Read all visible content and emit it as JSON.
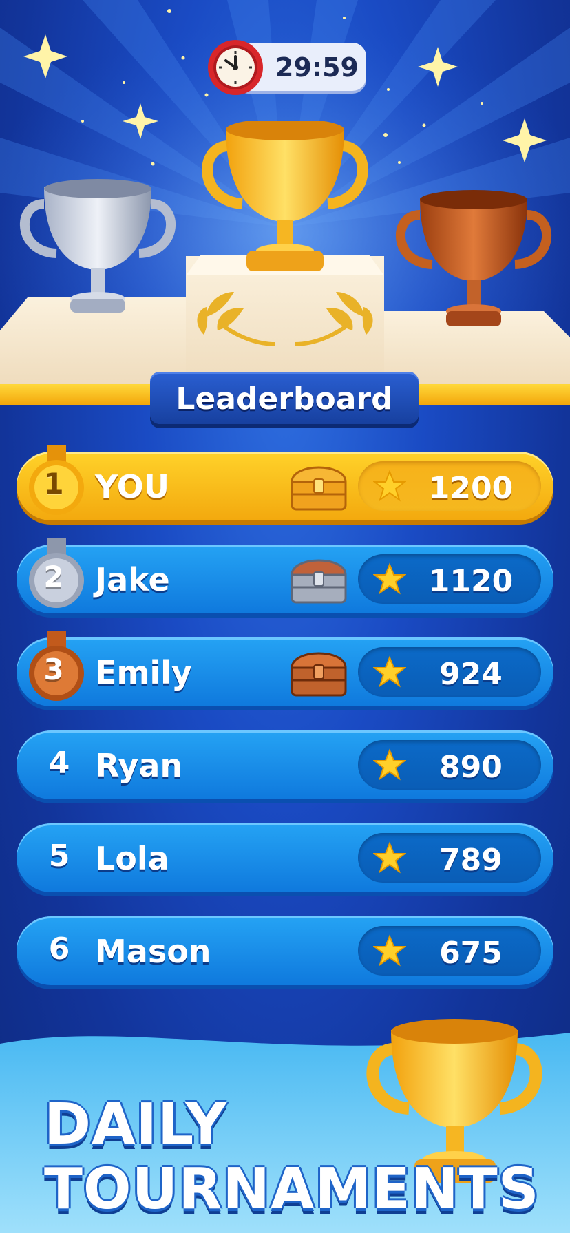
{
  "timer": {
    "value": "29:59",
    "icon": "clock-icon"
  },
  "banner": {
    "title": "Leaderboard"
  },
  "leaderboard": [
    {
      "rank": "1",
      "name": "YOU",
      "score": "1200",
      "medal": "gold",
      "chest": "gold-chest"
    },
    {
      "rank": "2",
      "name": "Jake",
      "score": "1120",
      "medal": "silver",
      "chest": "silver-chest"
    },
    {
      "rank": "3",
      "name": "Emily",
      "score": "924",
      "medal": "bronze",
      "chest": "bronze-chest"
    },
    {
      "rank": "4",
      "name": "Ryan",
      "score": "890"
    },
    {
      "rank": "5",
      "name": "Lola",
      "score": "789"
    },
    {
      "rank": "6",
      "name": "Mason",
      "score": "675"
    }
  ],
  "footer": {
    "line1": "DAILY",
    "line2": "TOURNAMENTS"
  },
  "colors": {
    "gold": "#ffc61a",
    "blue": "#1a8ee8",
    "background": "#1a4bc4"
  }
}
